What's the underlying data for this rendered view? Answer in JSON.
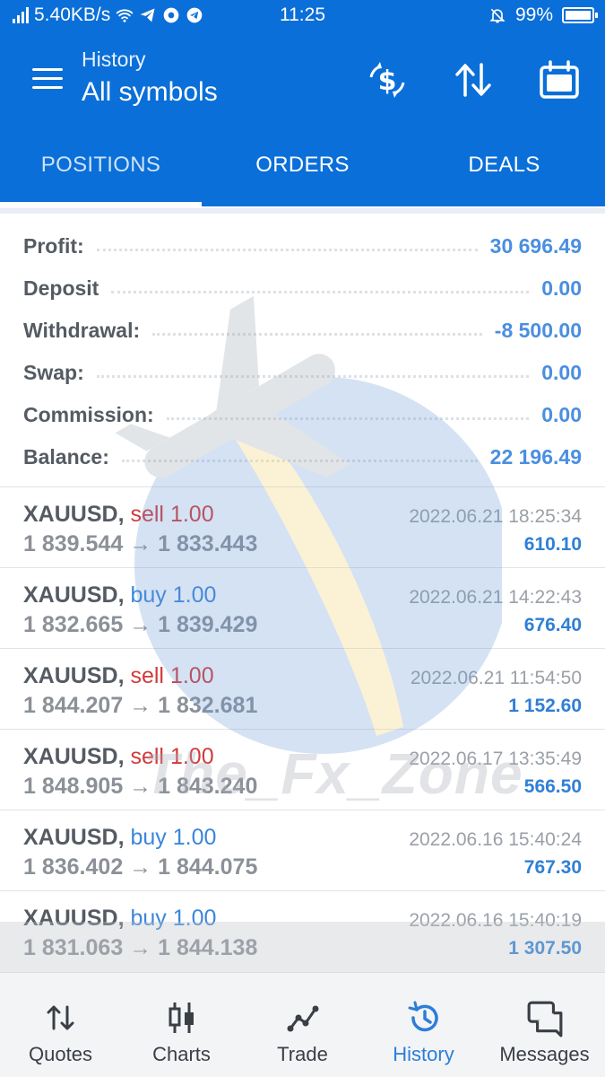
{
  "status_bar": {
    "net_speed": "5.40KB/s",
    "time": "11:25",
    "battery": "99%",
    "battery_level": 0.99
  },
  "app_bar": {
    "subtitle": "History",
    "title": "All symbols",
    "icons": [
      "menu-icon",
      "currency-exchange-icon",
      "sort-icon",
      "calendar-icon"
    ]
  },
  "tabs": [
    {
      "label": "POSITIONS",
      "active": true
    },
    {
      "label": "ORDERS",
      "active": false
    },
    {
      "label": "DEALS",
      "active": false
    }
  ],
  "summary": [
    {
      "label": "Profit:",
      "value": "30 696.49"
    },
    {
      "label": "Deposit",
      "value": "0.00"
    },
    {
      "label": "Withdrawal:",
      "value": "-8 500.00"
    },
    {
      "label": "Swap:",
      "value": "0.00"
    },
    {
      "label": "Commission:",
      "value": "0.00"
    },
    {
      "label": "Balance:",
      "value": "22 196.49"
    }
  ],
  "deals": [
    {
      "symbol": "XAUUSD,",
      "side": "sell",
      "volume": "1.00",
      "open": "1 839.544",
      "close": "1 833.443",
      "time": "2022.06.21 18:25:34",
      "profit": "610.10"
    },
    {
      "symbol": "XAUUSD,",
      "side": "buy",
      "volume": "1.00",
      "open": "1 832.665",
      "close": "1 839.429",
      "time": "2022.06.21 14:22:43",
      "profit": "676.40"
    },
    {
      "symbol": "XAUUSD,",
      "side": "sell",
      "volume": "1.00",
      "open": "1 844.207",
      "close": "1 832.681",
      "time": "2022.06.21 11:54:50",
      "profit": "1 152.60"
    },
    {
      "symbol": "XAUUSD,",
      "side": "sell",
      "volume": "1.00",
      "open": "1 848.905",
      "close": "1 843.240",
      "time": "2022.06.17 13:35:49",
      "profit": "566.50"
    },
    {
      "symbol": "XAUUSD,",
      "side": "buy",
      "volume": "1.00",
      "open": "1 836.402",
      "close": "1 844.075",
      "time": "2022.06.16 15:40:24",
      "profit": "767.30"
    },
    {
      "symbol": "XAUUSD,",
      "side": "buy",
      "volume": "1.00",
      "open": "1 831.063",
      "close": "1 844.138",
      "time": "2022.06.16 15:40:19",
      "profit": "1 307.50"
    }
  ],
  "watermark_text": "The_Fx_Zone",
  "bottom_nav": [
    {
      "label": "Quotes",
      "icon": "quotes-icon",
      "active": false
    },
    {
      "label": "Charts",
      "icon": "charts-icon",
      "active": false
    },
    {
      "label": "Trade",
      "icon": "trade-icon",
      "active": false
    },
    {
      "label": "History",
      "icon": "history-icon",
      "active": true
    },
    {
      "label": "Messages",
      "icon": "messages-icon",
      "active": false
    }
  ],
  "colors": {
    "brand": "#0a6fd8",
    "value_blue": "#4a8fe0",
    "sell_red": "#d23a3a",
    "buy_blue": "#3a86db",
    "active_nav": "#2b7ed8"
  }
}
